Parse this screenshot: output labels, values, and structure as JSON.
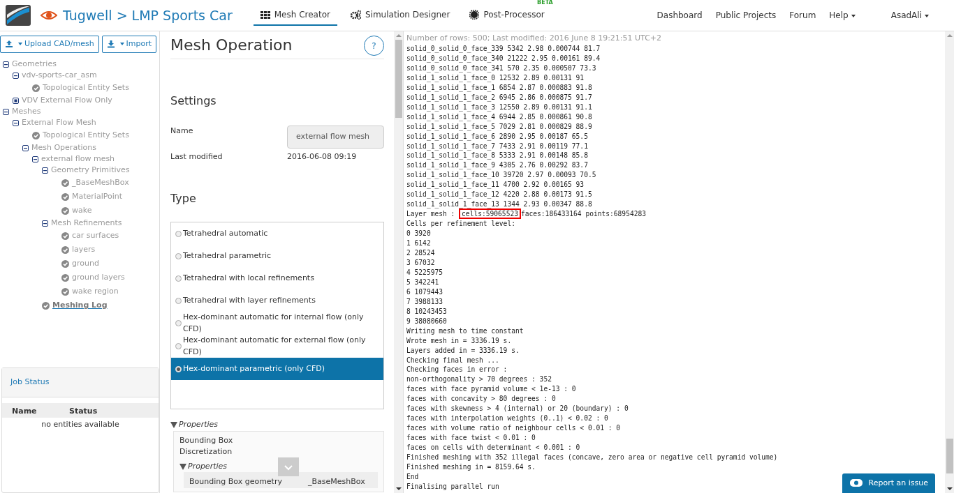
{
  "header": {
    "breadcrumb": "Tugwell > LMP Sports Car",
    "tabs": [
      {
        "label": "Mesh Creator",
        "selected": true
      },
      {
        "label": "Simulation Designer",
        "selected": false
      },
      {
        "label": "Post-Processor",
        "selected": false,
        "badge": "BETA"
      }
    ],
    "links": [
      {
        "label": "Dashboard"
      },
      {
        "label": "Public Projects"
      },
      {
        "label": "Forum"
      },
      {
        "label": "Help",
        "dropdown": true
      }
    ],
    "user": "AsadAli"
  },
  "sidebar": {
    "buttons": [
      {
        "label": "Upload CAD/mesh"
      },
      {
        "label": "Import"
      }
    ],
    "tree": [
      {
        "label": "Geometries",
        "expanded": true,
        "children": [
          {
            "label": "vdv-sports-car_asm",
            "expanded": true,
            "children": [
              {
                "label": "Topological Entity Sets"
              }
            ]
          },
          {
            "label": "VDV External Flow Only",
            "expanded": false
          }
        ]
      },
      {
        "label": "Meshes",
        "expanded": true,
        "children": [
          {
            "label": "External Flow Mesh",
            "expanded": true,
            "children": [
              {
                "label": "Topological Entity Sets"
              },
              {
                "label": "Mesh Operations",
                "expanded": true,
                "children": [
                  {
                    "label": "external flow mesh",
                    "expanded": true,
                    "children": [
                      {
                        "label": "Geometry Primitives",
                        "expanded": true,
                        "children": [
                          {
                            "label": "_BaseMeshBox"
                          },
                          {
                            "label": "MaterialPoint"
                          },
                          {
                            "label": "wake"
                          }
                        ]
                      },
                      {
                        "label": "Mesh Refinements",
                        "expanded": true,
                        "children": [
                          {
                            "label": "car surfaces"
                          },
                          {
                            "label": "layers"
                          },
                          {
                            "label": "ground"
                          },
                          {
                            "label": "ground layers"
                          },
                          {
                            "label": "wake region"
                          }
                        ]
                      },
                      {
                        "label": "Meshing Log",
                        "kind": "link"
                      }
                    ]
                  }
                ]
              }
            ]
          }
        ]
      }
    ],
    "job_status": {
      "title": "Job Status",
      "columns": [
        "Name",
        "Status"
      ],
      "empty": "no entities available"
    }
  },
  "panel": {
    "title": "Mesh Operation",
    "help": "?",
    "settings_heading": "Settings",
    "fields": [
      {
        "label": "Name",
        "value": "external flow mesh",
        "kind": "input"
      },
      {
        "label": "Last modified",
        "value": "2016-06-08 09:19",
        "kind": "text"
      }
    ],
    "type_heading": "Type",
    "types": [
      {
        "label": "Tetrahedral automatic",
        "selected": false
      },
      {
        "label": "Tetrahedral parametric",
        "selected": false
      },
      {
        "label": "Tetrahedral with local refinements",
        "selected": false
      },
      {
        "label": "Tetrahedral with layer refinements",
        "selected": false
      },
      {
        "label": "Hex-dominant automatic for internal flow (only CFD)",
        "selected": false
      },
      {
        "label": "Hex-dominant automatic for external flow (only CFD)",
        "selected": false
      },
      {
        "label": "Hex-dominant parametric (only CFD)",
        "selected": true
      }
    ],
    "properties": {
      "label": "Properties",
      "expanded": true,
      "items": [
        "Bounding Box",
        "Discretization"
      ],
      "sub": {
        "label": "Properties",
        "expanded": true,
        "rows": [
          {
            "name": "Bounding Box geometry",
            "value": "_BaseMeshBox"
          }
        ]
      }
    }
  },
  "log": {
    "info": "Number of rows: 500; Last modified: 2016 June 8 19:21:51 UTC+2",
    "lines": [
      {
        "text": "solid_0_solid_0_face_339 5342 2.98 0.000744 81.7"
      },
      {
        "text": "solid_0_solid_0_face_340 21222 2.95 0.00161 89.4"
      },
      {
        "text": "solid_0_solid_0_face_341 570 2.35 0.000507 73.3"
      },
      {
        "text": "solid_1_solid_1_face_0 12532 2.89 0.00131 91"
      },
      {
        "text": "solid_1_solid_1_face_1 6854 2.87 0.000883 91.8"
      },
      {
        "text": "solid_1_solid_1_face_2 6945 2.86 0.000875 91.7"
      },
      {
        "text": "solid_1_solid_1_face_3 12550 2.89 0.00131 91.1"
      },
      {
        "text": "solid_1_solid_1_face_4 6944 2.85 0.000861 90.8"
      },
      {
        "text": "solid_1_solid_1_face_5 7029 2.81 0.000829 88.9"
      },
      {
        "text": "solid_1_solid_1_face_6 2890 2.95 0.00187 65.5"
      },
      {
        "text": "solid_1_solid_1_face_7 7433 2.91 0.00119 77.1"
      },
      {
        "text": "solid_1_solid_1_face_8 5333 2.91 0.00148 85.8"
      },
      {
        "text": "solid_1_solid_1_face_9 4305 2.76 0.00292 83.7"
      },
      {
        "text": "solid_1_solid_1_face_10 39720 2.97 0.00093 70.5"
      },
      {
        "text": "solid_1_solid_1_face_11 4700 2.92 0.00165 93"
      },
      {
        "text": "solid_1_solid_1_face_12 4220 2.88 0.00173 91.5"
      },
      {
        "text": "solid_1_solid_1_face_13 1344 2.93 0.00347 88.8"
      },
      {
        "text": "Layer mesh : ",
        "highlight": "cells:59065523",
        "rest": "faces:186433164 points:68954283"
      },
      {
        "text": "Cells per refinement level:"
      },
      {
        "text": "0 3920"
      },
      {
        "text": "1 6142"
      },
      {
        "text": "2 28524"
      },
      {
        "text": "3 67032"
      },
      {
        "text": "4 5225975"
      },
      {
        "text": "5 342241"
      },
      {
        "text": "6 1079443"
      },
      {
        "text": "7 3988133"
      },
      {
        "text": "8 10243453"
      },
      {
        "text": "9 38080660"
      },
      {
        "text": "Writing mesh to time constant"
      },
      {
        "text": "Wrote mesh in = 3336.19 s."
      },
      {
        "text": "Layers added in = 3336.19 s."
      },
      {
        "text": "Checking final mesh ..."
      },
      {
        "text": "Checking faces in error :"
      },
      {
        "text": "non-orthogonality > 70 degrees : 352"
      },
      {
        "text": "faces with face pyramid volume < 1e-13 : 0"
      },
      {
        "text": "faces with concavity > 80 degrees : 0"
      },
      {
        "text": "faces with skewness > 4 (internal) or 20 (boundary) : 0"
      },
      {
        "text": "faces with interpolation weights (0..1) < 0.02 : 0"
      },
      {
        "text": "faces with volume ratio of neighbour cells < 0.01 : 0"
      },
      {
        "text": "faces with face twist < 0.01 : 0"
      },
      {
        "text": "faces on cells with determinant < 0.001 : 0"
      },
      {
        "text": "Finished meshing with 352 illegal faces (concave, zero area or negative cell pyramid volume)"
      },
      {
        "text": "Finished meshing in = 8159.64 s."
      },
      {
        "text": "End"
      },
      {
        "text": "Finalising parallel run"
      }
    ]
  },
  "report_button": "Report an issue"
}
